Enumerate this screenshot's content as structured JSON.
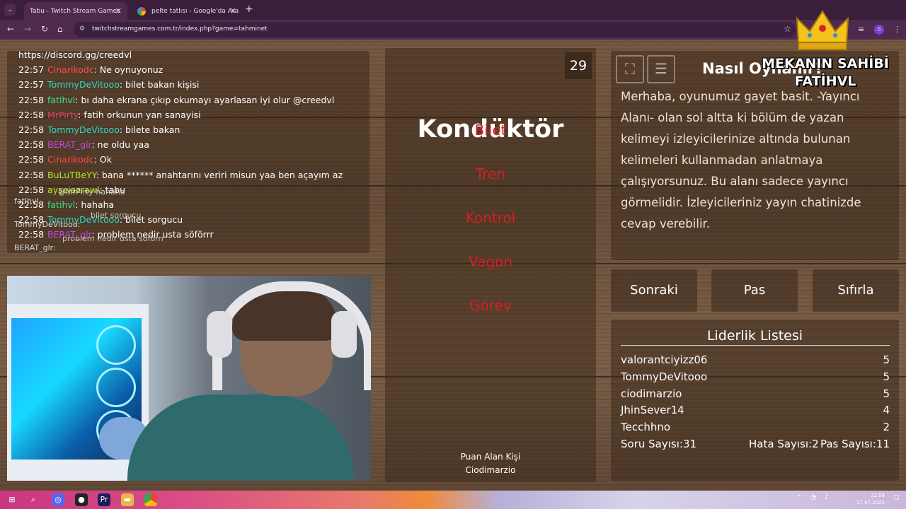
{
  "browser": {
    "tabs": [
      {
        "label": "Tabu - Twitch Stream Games",
        "active": true
      },
      {
        "label": "pelte tatlısı - Google'da Ara",
        "active": false
      }
    ],
    "url": "twitchstreamgames.com.tr/index.php?game=tahminet",
    "profile_initial": "ö"
  },
  "chat": {
    "lines": [
      {
        "time": "",
        "user": "",
        "text": "https://discord.gg/creedvl",
        "color": "#ffffff"
      },
      {
        "time": "22:57",
        "user": "Cinarikodc",
        "text": ": Ne oynuyonuz",
        "color": "#ff4a4a"
      },
      {
        "time": "22:57",
        "user": "TommyDeVitooo",
        "text": ": bilet bakan kişisi",
        "color": "#2bd9c4"
      },
      {
        "time": "22:58",
        "user": "fatihvl",
        "text": ": bı daha ekrana çıkıp okumayı ayarlasan iyi olur @creedvl",
        "color": "#3fe08a"
      },
      {
        "time": "22:58",
        "user": "MrPirty",
        "text": ": fatih orkunun yan sanayisi",
        "color": "#d9456a"
      },
      {
        "time": "22:58",
        "user": "TommyDeVitooo",
        "text": ": bilete bakan",
        "color": "#2bd9c4"
      },
      {
        "time": "22:58",
        "user": "BERAT_glr",
        "text": ": ne oldu yaa",
        "color": "#c44ad9"
      },
      {
        "time": "22:58",
        "user": "Cinarikodc",
        "text": ": Ok",
        "color": "#ff4a4a"
      },
      {
        "time": "22:58",
        "user": "BuLuTBeYY",
        "text": ": bana ****** anahtarını veriri misun yaa ben açayım az",
        "color": "#b8e62a"
      },
      {
        "time": "22:58",
        "user": "ayşejazrawl",
        "text": ": tabu",
        "color": "#b8e62a"
      },
      {
        "time": "22:58",
        "user": "fatihvl",
        "text": ": hahaha",
        "color": "#3fe08a"
      },
      {
        "time": "22:58",
        "user": "TommyDeVitooo",
        "text": ": bilet sorgucu",
        "color": "#2bd9c4"
      },
      {
        "time": "22:58",
        "user": "BERAT_glr",
        "text": ": problem nedir usta söförrr",
        "color": "#c44ad9"
      }
    ],
    "overlay": [
      {
        "user": "",
        "text": "@MrPirty hahaha"
      },
      {
        "user": "fatihvl",
        "text": ""
      },
      {
        "user": "",
        "text": "bilet sorgucu"
      },
      {
        "user": "TommyDeVitooo:",
        "text": ""
      },
      {
        "user": "",
        "text": "problem nedir usta söförrr"
      },
      {
        "user": "BERAT_glr:",
        "text": ""
      }
    ]
  },
  "game": {
    "word": "Kondüktör",
    "timer": "29",
    "taboo_words": [
      "Bilet",
      "Tren",
      "Kontrol",
      "Vagon",
      "Görev"
    ],
    "scorer_label": "Puan Alan Kişi",
    "scorer_name": "Ciodimarzio",
    "taboo_color": "#d41f25"
  },
  "howto": {
    "title": "Nasıl Oynanır?",
    "text": "Merhaba, oyunumuz gayet basit. -Yayıncı Alanı- olan sol altta ki bölüm de yazan kelimeyi izleyicilerinize altında bulunan kelimeleri kullanmadan anlatmaya çalışıyorsunuz. Bu alanı sadece yayıncı görmelidir. İzleyicileriniz yayın chatinizde cevap verebilir."
  },
  "owner": {
    "line1": "MEKANIN SAHİBİ",
    "line2": "FATİHVL"
  },
  "buttons": {
    "next": "Sonraki",
    "pass": "Pas",
    "reset": "Sıfırla"
  },
  "leaderboard": {
    "title": "Liderlik Listesi",
    "rows": [
      {
        "name": "valorantciyizz06",
        "score": "5"
      },
      {
        "name": "TommyDeVitooo",
        "score": "5"
      },
      {
        "name": "ciodimarzio",
        "score": "5"
      },
      {
        "name": "JhinSever14",
        "score": "4"
      },
      {
        "name": "Tecchhno",
        "score": "2"
      }
    ],
    "stats": {
      "questions_label": "Soru Sayısı:",
      "questions": "31",
      "errors_label": "Hata Sayısı:",
      "errors": "2",
      "passes_label": "Pas Sayısı:",
      "passes": "11"
    }
  },
  "taskbar": {
    "time": "22:58",
    "date": "17.07.2025"
  }
}
